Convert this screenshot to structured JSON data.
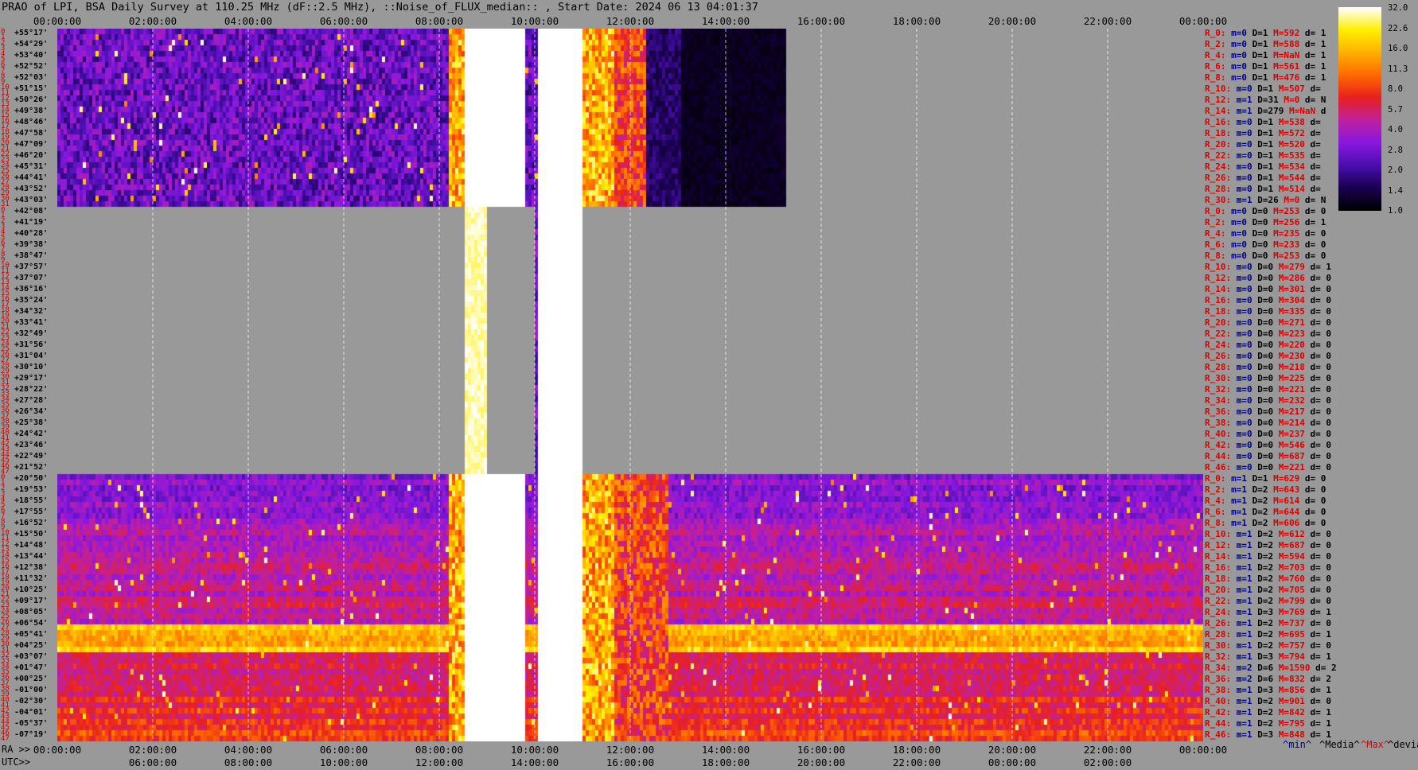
{
  "title": "PRAO of LPI, BSA Daily Survey at 110.25 MHz (dF::2.5 MHz), ::Noise_of_FLUX_median:: , Start Date: 2024 06 13 04:01:37",
  "chart_data": {
    "type": "heatmap",
    "title": "PRAO of LPI, BSA Daily Survey at 110.25 MHz (dF::2.5 MHz), ::Noise_of_FLUX_median:: , Start Date: 2024 06 13 04:01:37",
    "x_ra_ticks": [
      "00:00:00",
      "02:00:00",
      "04:00:00",
      "06:00:00",
      "08:00:00",
      "10:00:00",
      "12:00:00",
      "14:00:00",
      "16:00:00",
      "18:00:00",
      "20:00:00",
      "22:00:00",
      "00:00:00"
    ],
    "x_utc_ticks": [
      "06:00:00",
      "08:00:00",
      "10:00:00",
      "12:00:00",
      "14:00:00",
      "16:00:00",
      "18:00:00",
      "20:00:00",
      "22:00:00",
      "00:00:00",
      "02:00:00"
    ],
    "x_ra_prefix": "RA >>",
    "x_utc_prefix": "UTC>>",
    "declinations": [
      "+55°17'",
      "+54°29'",
      "+53°40'",
      "+52°52'",
      "+52°03'",
      "+51°15'",
      "+50°26'",
      "+49°38'",
      "+48°46'",
      "+47°58'",
      "+47°09'",
      "+46°20'",
      "+45°31'",
      "+44°41'",
      "+43°52'",
      "+43°03'",
      "+42°08'",
      "+41°19'",
      "+40°28'",
      "+39°38'",
      "+38°47'",
      "+37°57'",
      "+37°07'",
      "+36°16'",
      "+35°24'",
      "+34°32'",
      "+33°41'",
      "+32°49'",
      "+31°56'",
      "+31°04'",
      "+30°10'",
      "+29°17'",
      "+28°22'",
      "+27°28'",
      "+26°34'",
      "+25°38'",
      "+24°42'",
      "+23°46'",
      "+22°49'",
      "+21°52'",
      "+20°50'",
      "+19°53'",
      "+18°55'",
      "+17°55'",
      "+16°52'",
      "+15°50'",
      "+14°48'",
      "+13°44'",
      "+12°38'",
      "+11°32'",
      "+10°25'",
      "+09°17'",
      "+08°05'",
      "+06°54'",
      "+05°41'",
      "+04°25'",
      "+03°07'",
      "+01°47'",
      "+00°25'",
      "-01°00'",
      "-02°30'",
      "-04°01'",
      "-05°37'",
      "-07°19'"
    ],
    "colorbar_ticks": [
      "32.0",
      "22.6",
      "16.0",
      "11.3",
      "8.0",
      "5.7",
      "4.0",
      "2.8",
      "2.0",
      "1.4",
      "1.0"
    ],
    "colorbar_scale": "log",
    "colormap": [
      "#000000",
      "#1a0050",
      "#4a10b0",
      "#8a18e0",
      "#c020a0",
      "#e82020",
      "#ff6a00",
      "#ffb000",
      "#fff000",
      "#ffffff"
    ],
    "missing_color": "#999999",
    "sections": [
      {
        "rows": 16,
        "rows_index_start": 0,
        "coverage_ra_hours": [
          0,
          15
        ]
      },
      {
        "rows": 24,
        "rows_index_start": 0,
        "coverage_ra_hours": [
          9,
          10
        ]
      },
      {
        "rows": 24,
        "rows_index_start": 0,
        "coverage_ra_hours": [
          0,
          24
        ]
      }
    ],
    "saturated_band_ra_hours": [
      [
        8.5,
        9.7
      ],
      [
        10.0,
        11.0
      ]
    ]
  },
  "stats": [
    {
      "r": "R_0:",
      "m": "m=0",
      "d": "D=1",
      "med": "M=592",
      "dv": "d= 1"
    },
    {
      "r": "R_2:",
      "m": "m=0",
      "d": "D=1",
      "med": "M=588",
      "dv": "d= 1"
    },
    {
      "r": "R_4:",
      "m": "m=0",
      "d": "D=1",
      "med": "M=NaN",
      "dv": "d= 1"
    },
    {
      "r": "R_6:",
      "m": "m=0",
      "d": "D=1",
      "med": "M=561",
      "dv": "d= 1"
    },
    {
      "r": "R_8:",
      "m": "m=0",
      "d": "D=1",
      "med": "M=476",
      "dv": "d= 1"
    },
    {
      "r": "R_10:",
      "m": "m=0",
      "d": "D=1",
      "med": "M=507",
      "dv": "d="
    },
    {
      "r": "R_12:",
      "m": "m=1",
      "d": "D=31",
      "med": "M=0",
      "dv": "d= N"
    },
    {
      "r": "R_14:",
      "m": "m=1",
      "d": "D=279",
      "med": "M=NaN",
      "dv": "d"
    },
    {
      "r": "R_16:",
      "m": "m=0",
      "d": "D=1",
      "med": "M=538",
      "dv": "d="
    },
    {
      "r": "R_18:",
      "m": "m=0",
      "d": "D=1",
      "med": "M=572",
      "dv": "d="
    },
    {
      "r": "R_20:",
      "m": "m=0",
      "d": "D=1",
      "med": "M=520",
      "dv": "d="
    },
    {
      "r": "R_22:",
      "m": "m=0",
      "d": "D=1",
      "med": "M=535",
      "dv": "d="
    },
    {
      "r": "R_24:",
      "m": "m=0",
      "d": "D=1",
      "med": "M=534",
      "dv": "d="
    },
    {
      "r": "R_26:",
      "m": "m=0",
      "d": "D=1",
      "med": "M=544",
      "dv": "d="
    },
    {
      "r": "R_28:",
      "m": "m=0",
      "d": "D=1",
      "med": "M=514",
      "dv": "d="
    },
    {
      "r": "R_30:",
      "m": "m=1",
      "d": "D=26",
      "med": "M=0",
      "dv": "d= N"
    },
    {
      "r": "R_0:",
      "m": "m=0",
      "d": "D=0",
      "med": "M=253",
      "dv": "d= 0"
    },
    {
      "r": "R_2:",
      "m": "m=0",
      "d": "D=0",
      "med": "M=256",
      "dv": "d= 1"
    },
    {
      "r": "R_4:",
      "m": "m=0",
      "d": "D=0",
      "med": "M=235",
      "dv": "d= 0"
    },
    {
      "r": "R_6:",
      "m": "m=0",
      "d": "D=0",
      "med": "M=233",
      "dv": "d= 0"
    },
    {
      "r": "R_8:",
      "m": "m=0",
      "d": "D=0",
      "med": "M=253",
      "dv": "d= 0"
    },
    {
      "r": "R_10:",
      "m": "m=0",
      "d": "D=0",
      "med": "M=279",
      "dv": "d= 1"
    },
    {
      "r": "R_12:",
      "m": "m=0",
      "d": "D=0",
      "med": "M=286",
      "dv": "d= 0"
    },
    {
      "r": "R_14:",
      "m": "m=0",
      "d": "D=0",
      "med": "M=301",
      "dv": "d= 0"
    },
    {
      "r": "R_16:",
      "m": "m=0",
      "d": "D=0",
      "med": "M=304",
      "dv": "d= 0"
    },
    {
      "r": "R_18:",
      "m": "m=0",
      "d": "D=0",
      "med": "M=335",
      "dv": "d= 0"
    },
    {
      "r": "R_20:",
      "m": "m=0",
      "d": "D=0",
      "med": "M=271",
      "dv": "d= 0"
    },
    {
      "r": "R_22:",
      "m": "m=0",
      "d": "D=0",
      "med": "M=223",
      "dv": "d= 0"
    },
    {
      "r": "R_24:",
      "m": "m=0",
      "d": "D=0",
      "med": "M=220",
      "dv": "d= 0"
    },
    {
      "r": "R_26:",
      "m": "m=0",
      "d": "D=0",
      "med": "M=230",
      "dv": "d= 0"
    },
    {
      "r": "R_28:",
      "m": "m=0",
      "d": "D=0",
      "med": "M=218",
      "dv": "d= 0"
    },
    {
      "r": "R_30:",
      "m": "m=0",
      "d": "D=0",
      "med": "M=225",
      "dv": "d= 0"
    },
    {
      "r": "R_32:",
      "m": "m=0",
      "d": "D=0",
      "med": "M=221",
      "dv": "d= 0"
    },
    {
      "r": "R_34:",
      "m": "m=0",
      "d": "D=0",
      "med": "M=232",
      "dv": "d= 0"
    },
    {
      "r": "R_36:",
      "m": "m=0",
      "d": "D=0",
      "med": "M=217",
      "dv": "d= 0"
    },
    {
      "r": "R_38:",
      "m": "m=0",
      "d": "D=0",
      "med": "M=214",
      "dv": "d= 0"
    },
    {
      "r": "R_40:",
      "m": "m=0",
      "d": "D=0",
      "med": "M=237",
      "dv": "d= 0"
    },
    {
      "r": "R_42:",
      "m": "m=0",
      "d": "D=0",
      "med": "M=546",
      "dv": "d= 0"
    },
    {
      "r": "R_44:",
      "m": "m=0",
      "d": "D=0",
      "med": "M=687",
      "dv": "d= 0"
    },
    {
      "r": "R_46:",
      "m": "m=0",
      "d": "D=0",
      "med": "M=221",
      "dv": "d= 0"
    },
    {
      "r": "R_0:",
      "m": "m=1",
      "d": "D=1",
      "med": "M=629",
      "dv": "d= 0"
    },
    {
      "r": "R_2:",
      "m": "m=1",
      "d": "D=2",
      "med": "M=643",
      "dv": "d= 0"
    },
    {
      "r": "R_4:",
      "m": "m=1",
      "d": "D=2",
      "med": "M=614",
      "dv": "d= 0"
    },
    {
      "r": "R_6:",
      "m": "m=1",
      "d": "D=2",
      "med": "M=644",
      "dv": "d= 0"
    },
    {
      "r": "R_8:",
      "m": "m=1",
      "d": "D=2",
      "med": "M=606",
      "dv": "d= 0"
    },
    {
      "r": "R_10:",
      "m": "m=1",
      "d": "D=2",
      "med": "M=612",
      "dv": "d= 0"
    },
    {
      "r": "R_12:",
      "m": "m=1",
      "d": "D=2",
      "med": "M=687",
      "dv": "d= 0"
    },
    {
      "r": "R_14:",
      "m": "m=1",
      "d": "D=2",
      "med": "M=594",
      "dv": "d= 0"
    },
    {
      "r": "R_16:",
      "m": "m=1",
      "d": "D=2",
      "med": "M=703",
      "dv": "d= 0"
    },
    {
      "r": "R_18:",
      "m": "m=1",
      "d": "D=2",
      "med": "M=760",
      "dv": "d= 0"
    },
    {
      "r": "R_20:",
      "m": "m=1",
      "d": "D=2",
      "med": "M=705",
      "dv": "d= 0"
    },
    {
      "r": "R_22:",
      "m": "m=1",
      "d": "D=2",
      "med": "M=799",
      "dv": "d= 0"
    },
    {
      "r": "R_24:",
      "m": "m=1",
      "d": "D=3",
      "med": "M=769",
      "dv": "d= 1"
    },
    {
      "r": "R_26:",
      "m": "m=1",
      "d": "D=2",
      "med": "M=737",
      "dv": "d= 0"
    },
    {
      "r": "R_28:",
      "m": "m=1",
      "d": "D=2",
      "med": "M=695",
      "dv": "d= 1"
    },
    {
      "r": "R_30:",
      "m": "m=1",
      "d": "D=2",
      "med": "M=757",
      "dv": "d= 0"
    },
    {
      "r": "R_32:",
      "m": "m=1",
      "d": "D=3",
      "med": "M=794",
      "dv": "d= 1"
    },
    {
      "r": "R_34:",
      "m": "m=2",
      "d": "D=6",
      "med": "M=1590",
      "dv": "d= 2"
    },
    {
      "r": "R_36:",
      "m": "m=2",
      "d": "D=6",
      "med": "M=832",
      "dv": "d= 2"
    },
    {
      "r": "R_38:",
      "m": "m=1",
      "d": "D=3",
      "med": "M=856",
      "dv": "d= 1"
    },
    {
      "r": "R_40:",
      "m": "m=1",
      "d": "D=2",
      "med": "M=901",
      "dv": "d= 0"
    },
    {
      "r": "R_42:",
      "m": "m=1",
      "d": "D=2",
      "med": "M=842",
      "dv": "d= 1"
    },
    {
      "r": "R_44:",
      "m": "m=1",
      "d": "D=2",
      "med": "M=795",
      "dv": "d= 1"
    },
    {
      "r": "R_46:",
      "m": "m=1",
      "d": "D=3",
      "med": "M=848",
      "dv": "d= 1"
    }
  ],
  "footer": {
    "min": "^min^",
    "median": "^Media^",
    "max": "^Max^",
    "devia": "^devia^"
  },
  "colors": {
    "background": "#999999",
    "stat_label": "#dd0000",
    "stat_min": "#000080"
  }
}
